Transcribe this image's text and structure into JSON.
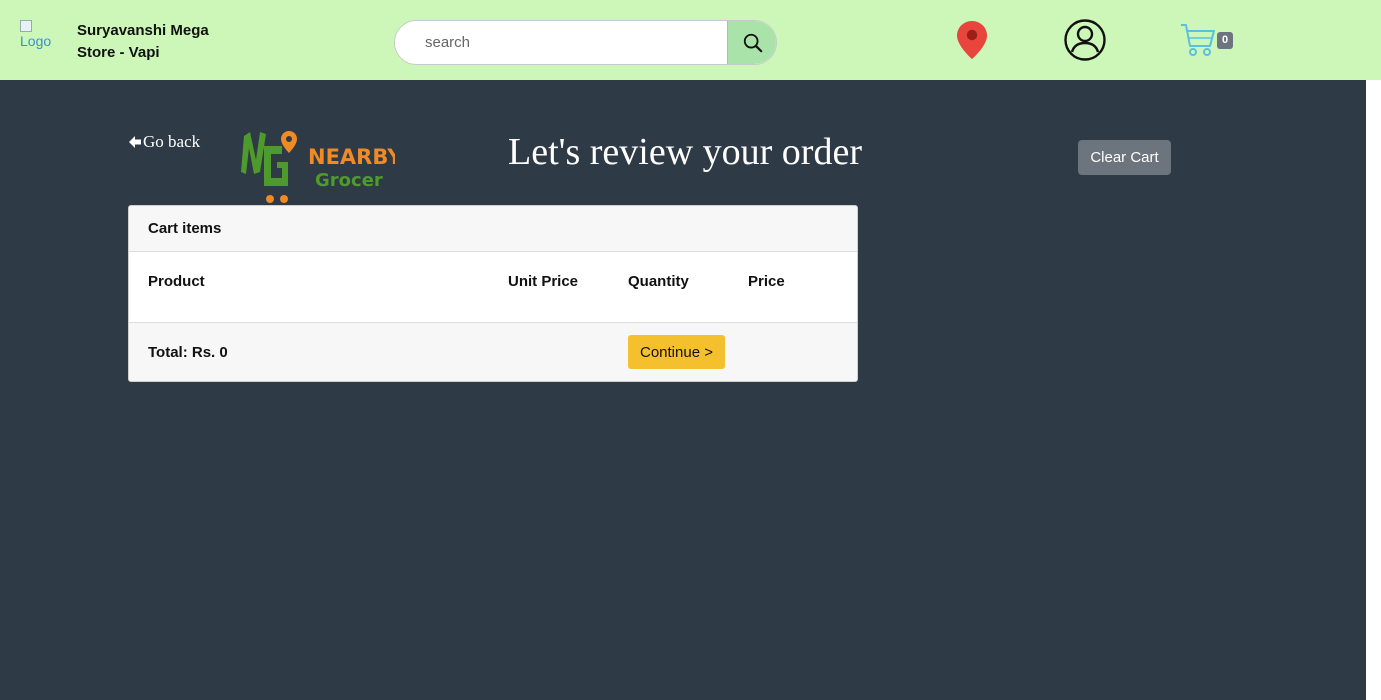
{
  "header": {
    "logo_alt": "Logo",
    "store_name": "Suryavanshi Mega Store - Vapi",
    "search_placeholder": "search",
    "cart_count": "0",
    "colors": {
      "background": "#cdf7b8",
      "search_button": "#a9e3a9",
      "location_pin": "#e8453c",
      "cart": "#5bc0de"
    }
  },
  "main": {
    "go_back_label": "Go back",
    "brand": {
      "line1": "NEARBY",
      "line2": "Grocer"
    },
    "title": "Let's review your order",
    "clear_cart_label": "Clear Cart",
    "cart": {
      "header": "Cart items",
      "columns": [
        "Product",
        "Unit Price",
        "Quantity",
        "Price"
      ],
      "rows": [],
      "total_label": "Total: Rs. 0",
      "continue_label": "Continue >"
    },
    "colors": {
      "background": "#2e3a45",
      "continue_button": "#f5c02e",
      "clear_button": "#6c757d"
    }
  }
}
